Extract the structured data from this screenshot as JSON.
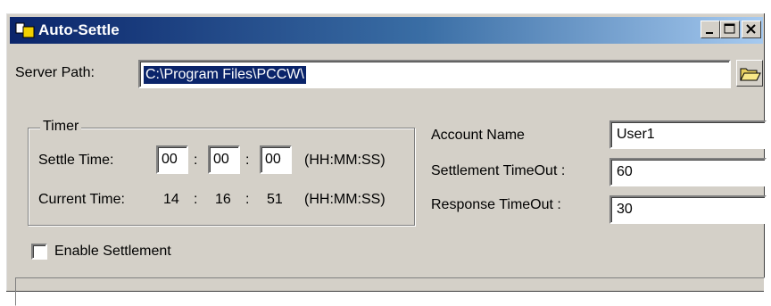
{
  "window": {
    "title": "Auto-Settle",
    "icon": "app-icon",
    "controls": [
      "minimize-icon",
      "maximize-icon",
      "close-icon"
    ]
  },
  "server_path": {
    "label": "Server Path:",
    "value": "C:\\Program Files\\PCCW\\",
    "browse_icon": "folder-open-icon"
  },
  "timer": {
    "group_title": "Timer",
    "settle_label": "Settle Time:",
    "settle": {
      "hh": "00",
      "mm": "00",
      "ss": "00"
    },
    "current_label": "Current Time:",
    "current": {
      "hh": "14",
      "mm": "16",
      "ss": "51"
    },
    "separator": ":",
    "format": "(HH:MM:SS)"
  },
  "settings": {
    "account_name_label": "Account Name",
    "account_name": "User1",
    "settlement_timeout_label": "Settlement TimeOut :",
    "settlement_timeout": "60",
    "response_timeout_label": "Response TimeOut :",
    "response_timeout": "30"
  },
  "enable_settlement": {
    "label": "Enable Settlement",
    "checked": false
  },
  "status_bar": {
    "text": ""
  }
}
